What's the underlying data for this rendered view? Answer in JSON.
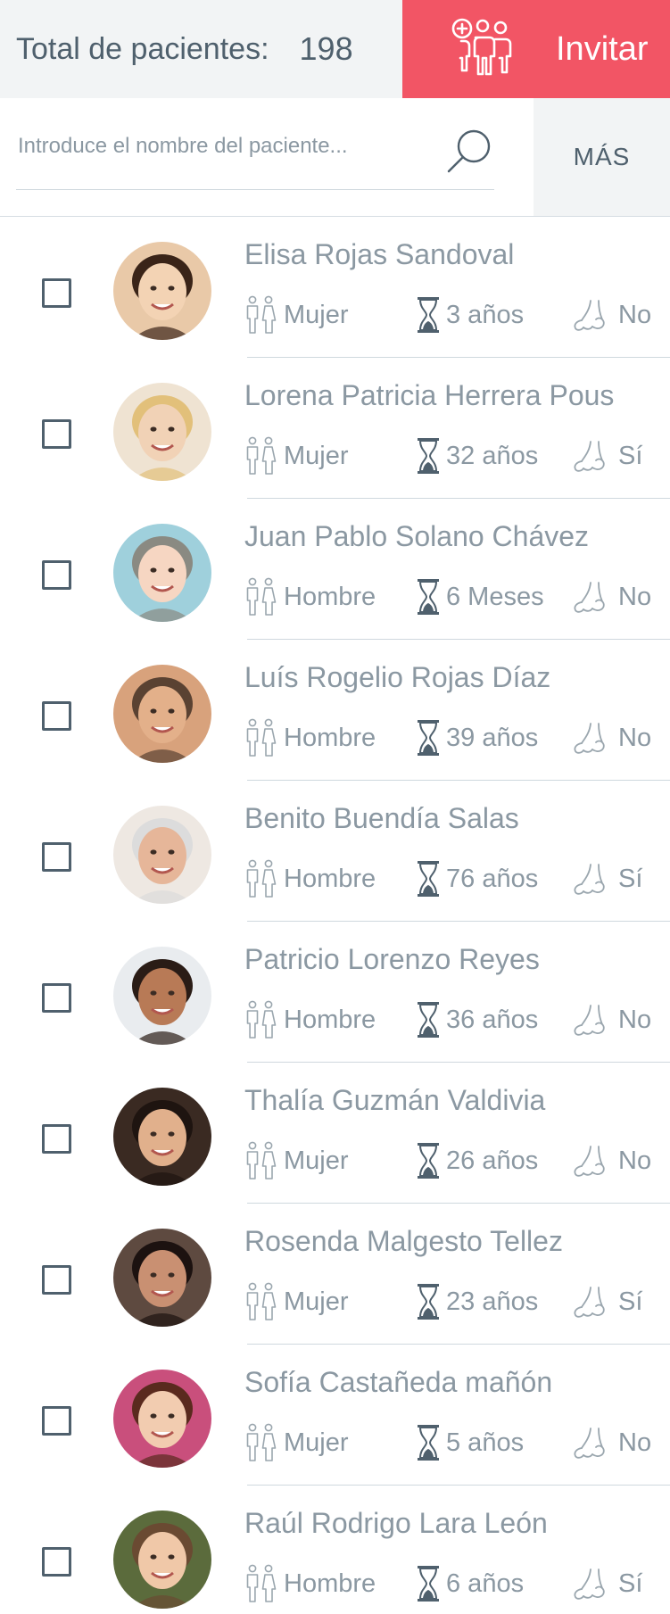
{
  "header": {
    "total_label": "Total de pacientes:",
    "total_count": "198",
    "invite_label": "Invitar",
    "invite_icon": "add-patients-icon",
    "accent_color": "#f25565"
  },
  "search": {
    "placeholder": "Introduce el nombre del paciente...",
    "value": "",
    "icon": "search-icon",
    "more_label": "MÁS"
  },
  "patients": [
    {
      "name": "Elisa Rojas Sandoval",
      "gender": "Mujer",
      "age": "3 años",
      "allergy": "No"
    },
    {
      "name": "Lorena Patricia Herrera Pous",
      "gender": "Mujer",
      "age": "32 años",
      "allergy": "Sí"
    },
    {
      "name": "Juan Pablo Solano Chávez",
      "gender": "Hombre",
      "age": "6 Meses",
      "allergy": "No"
    },
    {
      "name": "Luís Rogelio Rojas Díaz",
      "gender": "Hombre",
      "age": "39 años",
      "allergy": "No"
    },
    {
      "name": "Benito Buendía Salas",
      "gender": "Hombre",
      "age": "76 años",
      "allergy": "Sí"
    },
    {
      "name": "Patricio Lorenzo Reyes",
      "gender": "Hombre",
      "age": "36 años",
      "allergy": "No"
    },
    {
      "name": "Thalía Guzmán Valdivia",
      "gender": "Mujer",
      "age": "26 años",
      "allergy": "No"
    },
    {
      "name": "Rosenda Malgesto Tellez",
      "gender": "Mujer",
      "age": "23 años",
      "allergy": "Sí"
    },
    {
      "name": "Sofía Castañeda mañón",
      "gender": "Mujer",
      "age": "5 años",
      "allergy": "No"
    },
    {
      "name": "Raúl Rodrigo Lara León",
      "gender": "Hombre",
      "age": "6 años",
      "allergy": "Sí"
    }
  ]
}
